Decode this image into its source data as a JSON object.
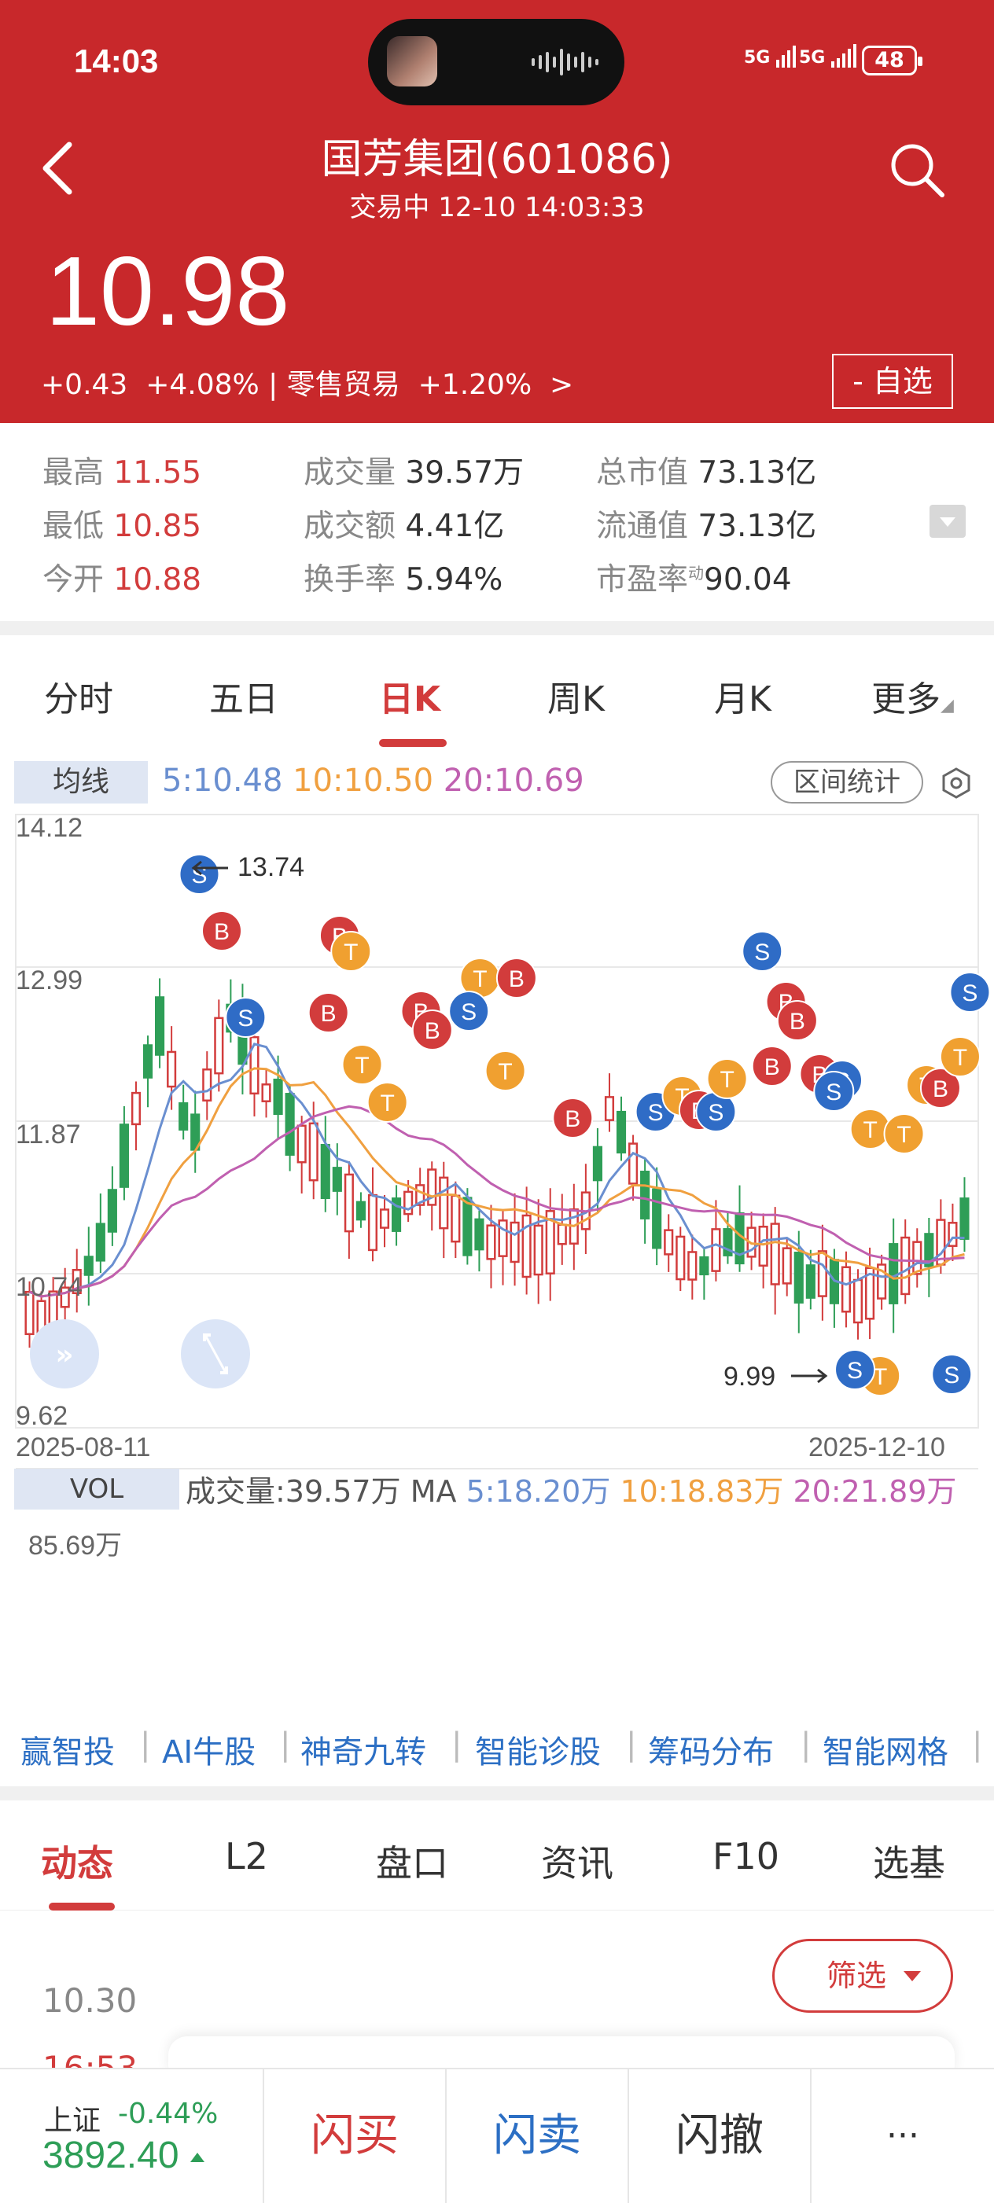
{
  "status": {
    "time": "14:03",
    "signal1": "5G",
    "signal2": "5G",
    "battery": "48"
  },
  "header": {
    "title": "国芳集团(601086)",
    "subtitle": "交易中   12-10 14:03:33",
    "price": "10.98",
    "change": "+0.43  +4.08% | 零售贸易  +1.20%  >",
    "watch_label": "- 自选"
  },
  "stats": [
    {
      "label": "最高",
      "value": "11.55",
      "red": true
    },
    {
      "label": "成交量",
      "value": "39.57万"
    },
    {
      "label": "总市值",
      "value": "73.13亿"
    },
    {
      "label": "最低",
      "value": "10.85",
      "red": true
    },
    {
      "label": "成交额",
      "value": "4.41亿"
    },
    {
      "label": "流通值",
      "value": "73.13亿"
    },
    {
      "label": "今开",
      "value": "10.88",
      "red": true
    },
    {
      "label": "换手率",
      "value": "5.94%"
    },
    {
      "label": "市盈率",
      "sup": "动",
      "value": "90.04"
    }
  ],
  "ktabs": [
    "分时",
    "五日",
    "日K",
    "周K",
    "月K",
    "更多"
  ],
  "ma": {
    "tag": "均线",
    "ma5": "5:10.48",
    "ma10": "10:10.50",
    "ma20": "20:10.69",
    "range_label": "区间统计"
  },
  "chart_axis": {
    "ymax": "14.12",
    "y2": "12.99",
    "y3": "11.87",
    "y4": "10.74",
    "ymin": "9.62",
    "start_date": "2025-08-11",
    "end_date": "2025-12-10",
    "high_label": "13.74",
    "low_label": "9.99"
  },
  "vol": {
    "tag": "VOL",
    "text": "成交量:39.57万",
    "ma_prefix": "MA",
    "ma5": "5:18.20万",
    "ma10": "10:18.83万",
    "ma20": "20:21.89万",
    "max": "85.69万"
  },
  "colors": {
    "brand": "#c8282b",
    "up": "#d23c3c",
    "down": "#2e9e57",
    "ma5": "#6a8fd0",
    "ma10": "#f0a040",
    "ma20": "#c060b0"
  },
  "tools": [
    "赢智投",
    "AI牛股",
    "神奇九转",
    "智能诊股",
    "筹码分布",
    "智能网格"
  ],
  "btabs": [
    "动态",
    "L2",
    "盘口",
    "资讯",
    "F10",
    "选基"
  ],
  "feed": {
    "filter": "筛选",
    "num": "10.30",
    "time": "16:53"
  },
  "bottom": {
    "index_name": "上证",
    "index_change": "-0.44%",
    "index_value": "3892.40",
    "buy": "闪买",
    "sell": "闪卖",
    "cancel": "闪撤",
    "more": "···"
  }
}
